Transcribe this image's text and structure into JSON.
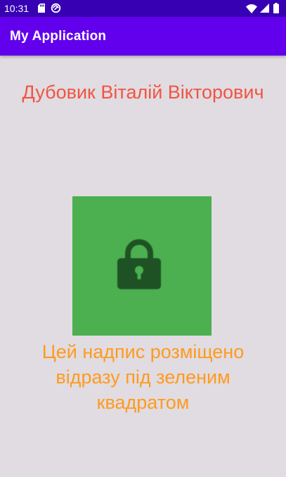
{
  "status_bar": {
    "time": "10:31",
    "background": "#3700b3",
    "icons": [
      "sd-card-icon",
      "data-saver-icon",
      "wifi-icon",
      "cell-signal-icon",
      "battery-icon"
    ]
  },
  "app_bar": {
    "title": "My Application",
    "background": "#6200ee"
  },
  "content": {
    "author_name": "Дубовик Віталій Вікторович",
    "author_color": "#f15443",
    "square_color": "#4caf50",
    "square_icon": "lock-icon",
    "caption": "Цей надпис розміщено відразу під зеленим квадратом",
    "caption_color": "#ff9a1f"
  }
}
